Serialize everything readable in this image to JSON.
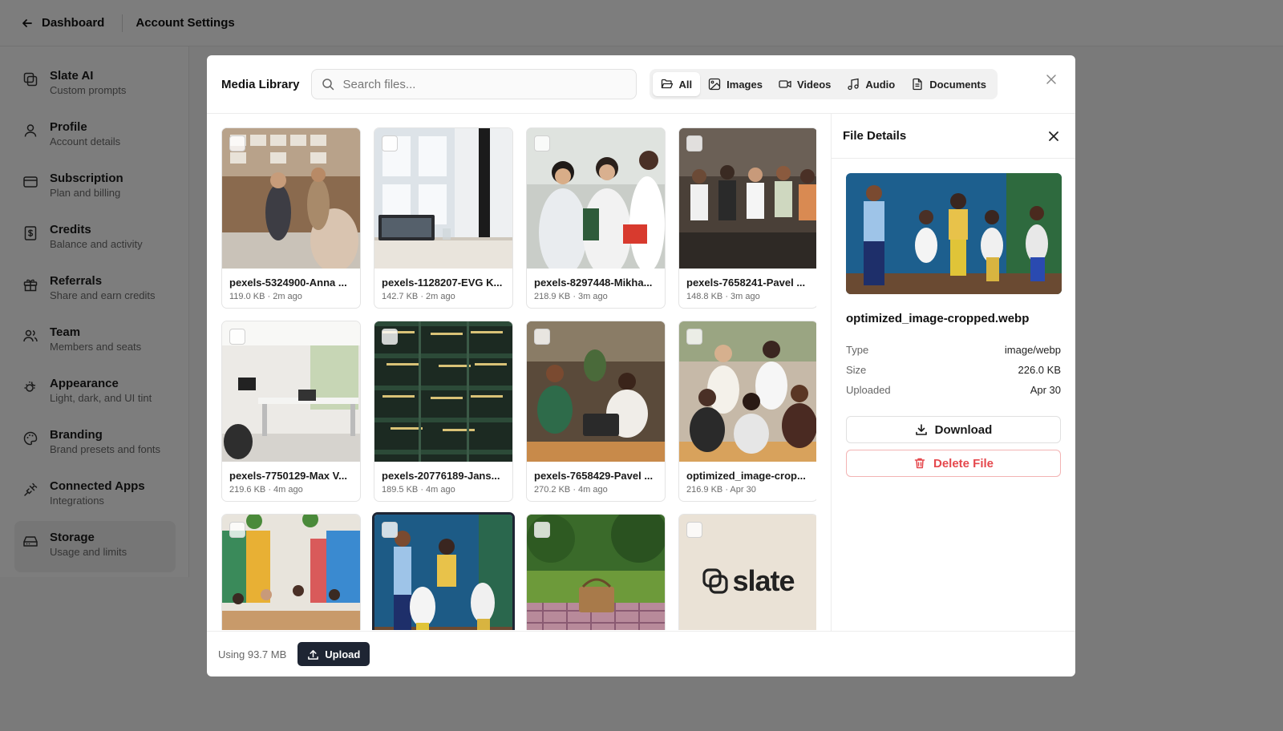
{
  "topbar": {
    "back_label": "Dashboard",
    "page_title": "Account Settings"
  },
  "sidebar": {
    "items": [
      {
        "title": "Slate AI",
        "subtitle": "Custom prompts",
        "icon": "copy-icon"
      },
      {
        "title": "Profile",
        "subtitle": "Account details",
        "icon": "user-icon"
      },
      {
        "title": "Subscription",
        "subtitle": "Plan and billing",
        "icon": "credit-card-icon"
      },
      {
        "title": "Credits",
        "subtitle": "Balance and activity",
        "icon": "receipt-icon"
      },
      {
        "title": "Referrals",
        "subtitle": "Share and earn credits",
        "icon": "gift-icon"
      },
      {
        "title": "Team",
        "subtitle": "Members and seats",
        "icon": "users-icon"
      },
      {
        "title": "Appearance",
        "subtitle": "Light, dark, and UI tint",
        "icon": "sun-moon-icon"
      },
      {
        "title": "Branding",
        "subtitle": "Brand presets and fonts",
        "icon": "palette-icon"
      },
      {
        "title": "Connected Apps",
        "subtitle": "Integrations",
        "icon": "plug-icon"
      },
      {
        "title": "Storage",
        "subtitle": "Usage and limits",
        "icon": "hard-drive-icon"
      }
    ],
    "active": "Storage"
  },
  "modal": {
    "title": "Media Library",
    "search_placeholder": "Search files...",
    "filters": [
      {
        "label": "All",
        "icon": "folder-open-icon"
      },
      {
        "label": "Images",
        "icon": "image-icon"
      },
      {
        "label": "Videos",
        "icon": "video-icon"
      },
      {
        "label": "Audio",
        "icon": "music-icon"
      },
      {
        "label": "Documents",
        "icon": "file-text-icon"
      }
    ],
    "active_filter": "All",
    "files": [
      {
        "name": "pexels-5324900-Anna ...",
        "meta": "119.0 KB · 2m ago"
      },
      {
        "name": "pexels-1128207-EVG K...",
        "meta": "142.7 KB · 2m ago"
      },
      {
        "name": "pexels-8297448-Mikha...",
        "meta": "218.9 KB · 3m ago"
      },
      {
        "name": "pexels-7658241-Pavel ...",
        "meta": "148.8 KB · 3m ago"
      },
      {
        "name": "pexels-7750129-Max V...",
        "meta": "219.6 KB · 4m ago"
      },
      {
        "name": "pexels-20776189-Jans...",
        "meta": "189.5 KB · 4m ago"
      },
      {
        "name": "pexels-7658429-Pavel ...",
        "meta": "270.2 KB · 4m ago"
      },
      {
        "name": "optimized_image-crop...",
        "meta": "216.9 KB · Apr 30"
      },
      {
        "name": "",
        "meta": ""
      },
      {
        "name": "",
        "meta": ""
      },
      {
        "name": "",
        "meta": ""
      },
      {
        "name": "",
        "meta": ""
      }
    ],
    "logo_text": "slate",
    "footer": {
      "usage": "Using 93.7 MB",
      "upload_label": "Upload"
    }
  },
  "details": {
    "title": "File Details",
    "file_name": "optimized_image-cropped.webp",
    "rows": [
      {
        "key": "Type",
        "value": "image/webp"
      },
      {
        "key": "Size",
        "value": "226.0 KB"
      },
      {
        "key": "Uploaded",
        "value": "Apr 30"
      }
    ],
    "download_label": "Download",
    "delete_label": "Delete File"
  },
  "colors": {
    "accent_dark": "#1e2533",
    "danger": "#e5484d",
    "overlay": "rgba(0,0,0,0.5)"
  }
}
